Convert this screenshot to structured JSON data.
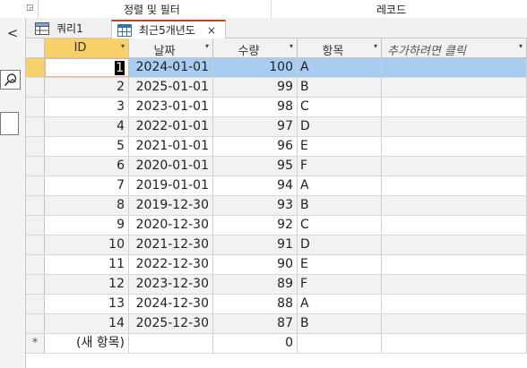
{
  "ribbon": {
    "group_sort_filter": "정렬 및 필터",
    "group_records": "레코드"
  },
  "nav": {
    "collapse_glyph": "<",
    "expand_glyph": "^"
  },
  "tabs": [
    {
      "label": "쿼리1",
      "icon": "query-icon",
      "active": false
    },
    {
      "label": "최근5개년도",
      "icon": "table-icon",
      "active": true,
      "close": "×"
    }
  ],
  "table": {
    "columns": [
      {
        "label": "ID"
      },
      {
        "label": "날짜"
      },
      {
        "label": "수량"
      },
      {
        "label": "항목"
      },
      {
        "label": "추가하려면 클릭"
      }
    ],
    "rows": [
      {
        "id": "1",
        "date": "2024-01-01",
        "qty": "100",
        "item": "A"
      },
      {
        "id": "2",
        "date": "2025-01-01",
        "qty": "99",
        "item": "B"
      },
      {
        "id": "3",
        "date": "2023-01-01",
        "qty": "98",
        "item": "C"
      },
      {
        "id": "4",
        "date": "2022-01-01",
        "qty": "97",
        "item": "D"
      },
      {
        "id": "5",
        "date": "2021-01-01",
        "qty": "96",
        "item": "E"
      },
      {
        "id": "6",
        "date": "2020-01-01",
        "qty": "95",
        "item": "F"
      },
      {
        "id": "7",
        "date": "2019-01-01",
        "qty": "94",
        "item": "A"
      },
      {
        "id": "8",
        "date": "2019-12-30",
        "qty": "93",
        "item": "B"
      },
      {
        "id": "9",
        "date": "2020-12-30",
        "qty": "92",
        "item": "C"
      },
      {
        "id": "10",
        "date": "2021-12-30",
        "qty": "91",
        "item": "D"
      },
      {
        "id": "11",
        "date": "2022-12-30",
        "qty": "90",
        "item": "E"
      },
      {
        "id": "12",
        "date": "2023-12-30",
        "qty": "89",
        "item": "F"
      },
      {
        "id": "13",
        "date": "2024-12-30",
        "qty": "88",
        "item": "A"
      },
      {
        "id": "14",
        "date": "2025-12-30",
        "qty": "87",
        "item": "B"
      }
    ],
    "new_row": {
      "marker": "*",
      "id": "(새 항목)",
      "qty": "0"
    },
    "dropdown_glyph": "▾"
  },
  "colors": {
    "selected_row": "#a9cdf0",
    "active_header": "#f7d06a",
    "active_tab_accent": "#b7472a"
  }
}
